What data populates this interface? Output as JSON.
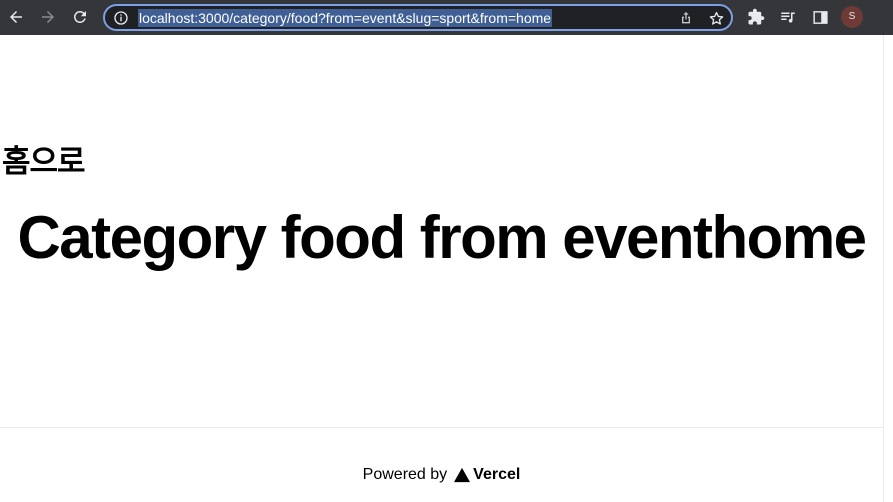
{
  "browser": {
    "url": "localhost:3000/category/food?from=event&slug=sport&from=home",
    "profile_initial": "S",
    "icons": {
      "back": "arrow-left-icon",
      "forward": "arrow-right-icon",
      "reload": "reload-icon",
      "info": "info-icon",
      "share": "share-icon",
      "bookmark": "star-icon",
      "extensions": "puzzle-icon",
      "media": "media-control-icon",
      "side_panel": "side-panel-icon"
    },
    "colors": {
      "toolbar": "#35363a",
      "omnibox_border": "#7ca0e6",
      "selection": "#3f5f95"
    }
  },
  "page": {
    "home_link": "홈으로",
    "headline": "Category food from eventhome",
    "footer": {
      "powered_by": "Powered by",
      "brand": "Vercel"
    }
  }
}
